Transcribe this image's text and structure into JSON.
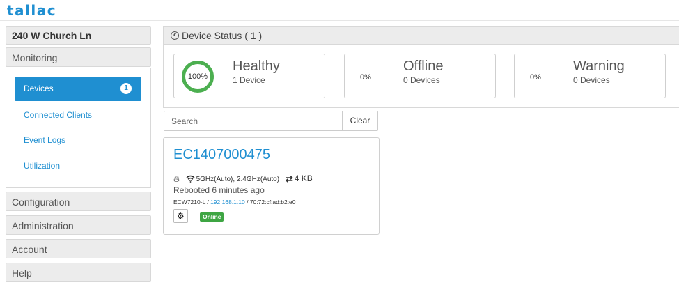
{
  "app": {
    "logo": "tallac"
  },
  "sidebar": {
    "location": "240 W Church Ln",
    "monitoring_label": "Monitoring",
    "monitoring_items": [
      {
        "label": "Devices",
        "badge": "1",
        "active": true
      },
      {
        "label": "Connected Clients"
      },
      {
        "label": "Event Logs"
      },
      {
        "label": "Utilization"
      }
    ],
    "sections": [
      "Configuration",
      "Administration",
      "Account",
      "Help"
    ]
  },
  "status": {
    "header": "Device Status ( 1 )",
    "cards": [
      {
        "pct": "100%",
        "title": "Healthy",
        "sub": "1 Device",
        "color": "#4caf50"
      },
      {
        "pct": "0%",
        "title": "Offline",
        "sub": "0 Devices"
      },
      {
        "pct": "0%",
        "title": "Warning",
        "sub": "0 Devices"
      }
    ]
  },
  "search": {
    "placeholder": "Search",
    "clear_label": "Clear"
  },
  "device": {
    "name": "EC1407000475",
    "radios": "5GHz(Auto), 2.4GHz(Auto)",
    "traffic": "4 KB",
    "reboot": "Rebooted 6 minutes ago",
    "model": "ECW7210-L",
    "ip": "192.168.1.10",
    "mac": "70:72:cf:ad:b2:e0",
    "status_badge": "Online"
  },
  "colors": {
    "accent": "#1f8fd1",
    "online": "#3ea543"
  }
}
